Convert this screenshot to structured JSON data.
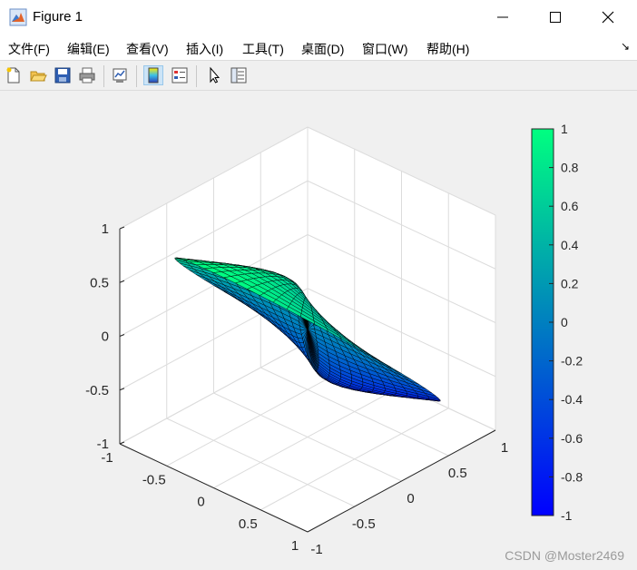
{
  "window": {
    "title": "Figure 1",
    "controls": {
      "minimize": "minimize",
      "maximize": "maximize",
      "close": "close"
    }
  },
  "menu": {
    "items": [
      "文件(F)",
      "编辑(E)",
      "查看(V)",
      "插入(I)",
      "工具(T)",
      "桌面(D)",
      "窗口(W)",
      "帮助(H)"
    ],
    "overflow_glyph": "↘"
  },
  "toolbar": {
    "buttons": [
      "new-figure",
      "open-file",
      "save",
      "print",
      "link-plot",
      "toggle-colorbar",
      "insert-legend",
      "edit-plot",
      "property-inspector"
    ]
  },
  "chart_data": {
    "type": "surface",
    "title": "",
    "colormap": "winter",
    "grid": true,
    "x_ticks": [
      "-1",
      "-0.5",
      "0",
      "0.5",
      "1"
    ],
    "y_ticks": [
      "-1",
      "-0.5",
      "0",
      "0.5",
      "1"
    ],
    "z_ticks": [
      "-1",
      "-0.5",
      "0",
      "0.5",
      "1"
    ],
    "xlim": [
      -1,
      1
    ],
    "ylim": [
      -1,
      1
    ],
    "zlim": [
      -1,
      1
    ],
    "colorbar": {
      "range": [
        -1,
        1
      ],
      "ticks": [
        "1",
        "0.8",
        "0.6",
        "0.4",
        "0.2",
        "0",
        "-0.2",
        "-0.4",
        "-0.6",
        "-0.8",
        "-1"
      ],
      "color_top": "#00ff80",
      "color_bottom": "#0000ff"
    },
    "surface": {
      "description_function": "z = sin(theta) on a helicoid-like disk",
      "radial_range": [
        0,
        1
      ],
      "angle_range_deg": [
        0,
        360
      ],
      "radial_steps": 12,
      "angle_steps": 60
    }
  },
  "watermark": "CSDN @Moster2469",
  "colors": {
    "figure_bg": "#f0f0f0",
    "axes_line": "#262626",
    "grid": "#dcdcdc",
    "edge": "#000000"
  }
}
